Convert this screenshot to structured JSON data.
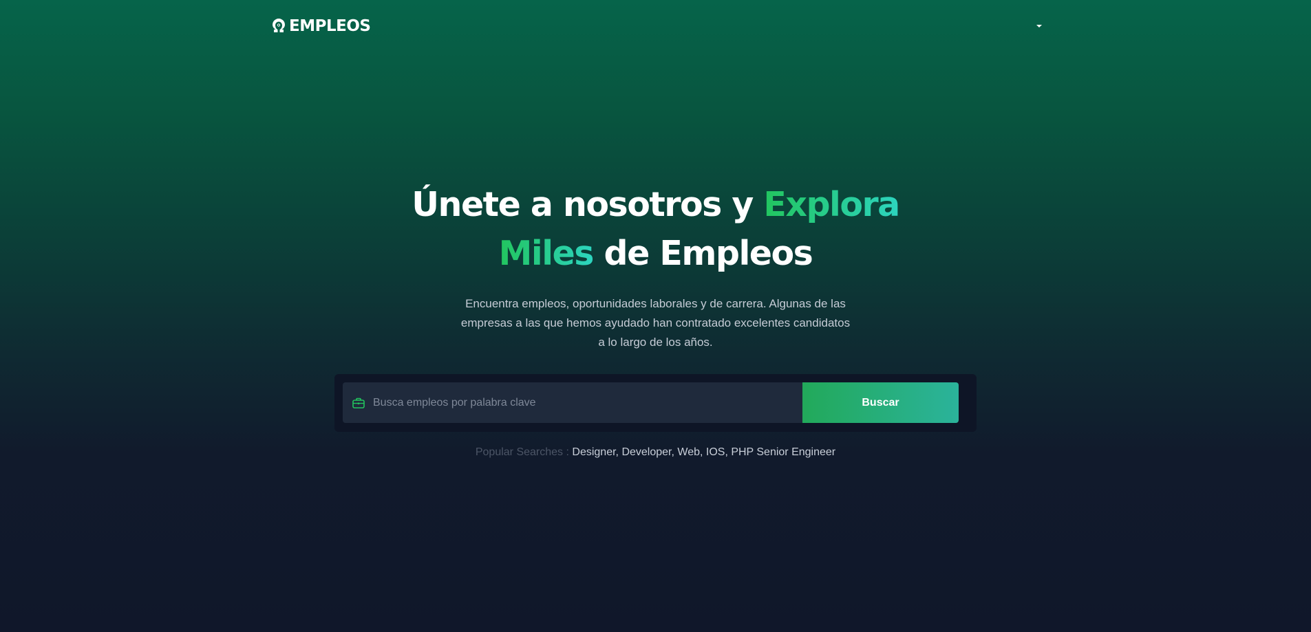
{
  "brand": {
    "name": "EMPLEOS",
    "logo_icon": "horseshoe-magnet-icon"
  },
  "header": {
    "language_caret_icon": "caret-down-icon"
  },
  "hero": {
    "title_part1": "Únete a nosotros y ",
    "title_accent1": "Explora",
    "title_accent2": "Miles",
    "title_part2": " de Empleos",
    "subtitle": "Encuentra empleos, oportunidades laborales y de carrera. Algunas de las empresas a las que hemos ayudado han contratado excelentes candidatos a lo largo de los años."
  },
  "search": {
    "icon": "briefcase-icon",
    "placeholder": "Busca empleos por palabra clave",
    "value": "",
    "button_label": "Buscar"
  },
  "popular": {
    "label": "Popular Searches : ",
    "items": [
      "Designer",
      "Developer",
      "Web",
      "IOS",
      "PHP Senior Engineer"
    ],
    "separator": ", "
  },
  "colors": {
    "accent_green": "#22c55e",
    "accent_teal": "#2dd4bf",
    "background_dark": "#10172a",
    "background_green": "#06644a"
  }
}
